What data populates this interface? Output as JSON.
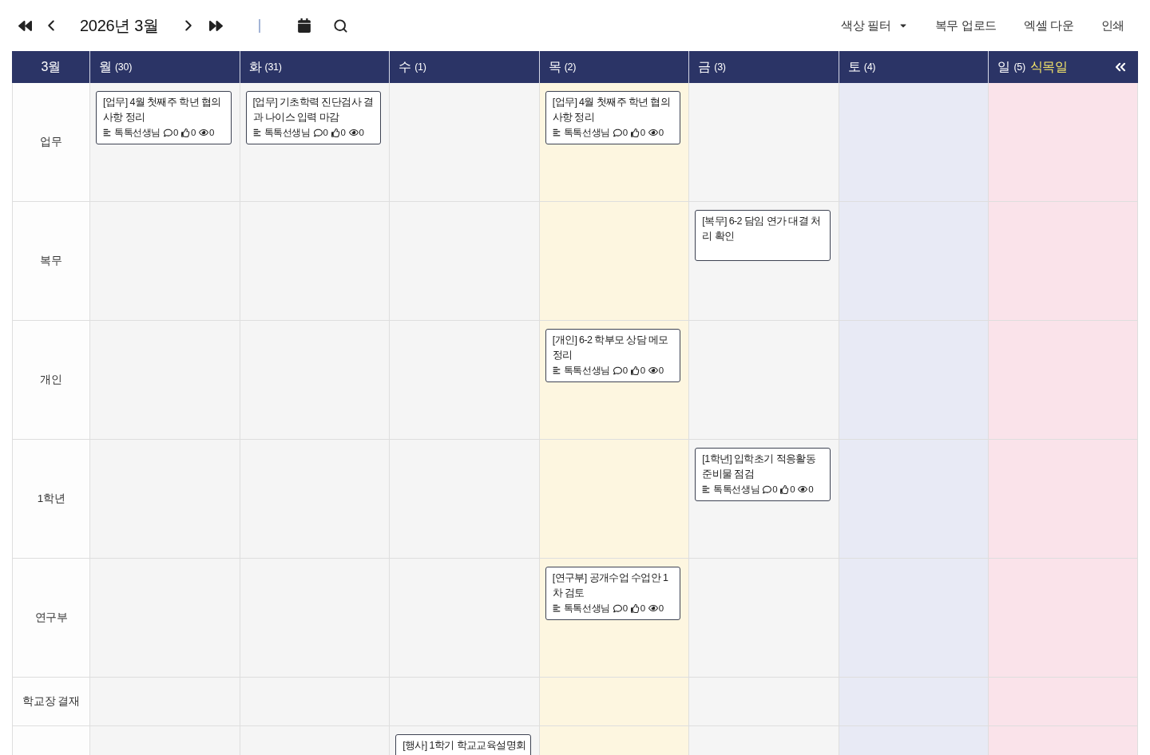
{
  "toolbar": {
    "title": "2026년 3월",
    "menu": [
      {
        "label": "색상 필터",
        "kind": "dropdown"
      },
      {
        "label": "복무 업로드",
        "kind": "link"
      },
      {
        "label": "엑셀 다운",
        "kind": "link"
      },
      {
        "label": "인쇄",
        "kind": "link"
      }
    ]
  },
  "header": {
    "month": "3월",
    "days": [
      {
        "weekday": "월",
        "date": "(30)",
        "kind": "weekday",
        "today": false
      },
      {
        "weekday": "화",
        "date": "(31)",
        "kind": "weekday",
        "today": false
      },
      {
        "weekday": "수",
        "date": "(1)",
        "kind": "weekday",
        "today": false
      },
      {
        "weekday": "목",
        "date": "(2)",
        "kind": "weekday",
        "today": true
      },
      {
        "weekday": "금",
        "date": "(3)",
        "kind": "weekday",
        "today": false
      },
      {
        "weekday": "토",
        "date": "(4)",
        "kind": "saturday",
        "today": false
      },
      {
        "weekday": "일",
        "date": "(5)",
        "kind": "sunday",
        "today": false,
        "holiday": "식목일"
      }
    ]
  },
  "rows": [
    {
      "label": "업무",
      "cells": [
        {
          "events": [
            {
              "title": "[업무] 4월 첫째주 학년 협의 사항 정리",
              "author": "톡톡선생님",
              "comments": "0",
              "likes": "0",
              "views": "0"
            }
          ]
        },
        {
          "events": [
            {
              "title": "[업무] 기초학력 진단검사 결과 나이스 입력 마감",
              "author": "톡톡선생님",
              "comments": "0",
              "likes": "0",
              "views": "0"
            }
          ]
        },
        {},
        {
          "events": [
            {
              "title": "[업무] 4월 첫째주 학년 협의 사항 정리",
              "author": "톡톡선생님",
              "comments": "0",
              "likes": "0",
              "views": "0"
            }
          ]
        },
        {},
        {},
        {}
      ]
    },
    {
      "label": "복무",
      "cells": [
        {},
        {},
        {},
        {},
        {
          "events": [
            {
              "title": "[복무] 6-2 담임 연가 대결 처리 확인"
            }
          ]
        },
        {},
        {}
      ]
    },
    {
      "label": "개인",
      "cells": [
        {},
        {},
        {},
        {
          "events": [
            {
              "title": "[개인] 6-2 학부모 상담 메모 정리",
              "author": "톡톡선생님",
              "comments": "0",
              "likes": "0",
              "views": "0"
            }
          ]
        },
        {},
        {},
        {}
      ]
    },
    {
      "label": "1학년",
      "cells": [
        {},
        {},
        {},
        {},
        {
          "events": [
            {
              "title": "[1학년] 입학초기 적응활동 준비물 점검",
              "author": "톡톡선생님",
              "comments": "0",
              "likes": "0",
              "views": "0"
            }
          ]
        },
        {},
        {}
      ]
    },
    {
      "label": "연구부",
      "cells": [
        {},
        {},
        {},
        {
          "events": [
            {
              "title": "[연구부] 공개수업 수업안 1차 검토",
              "author": "톡톡선생님",
              "comments": "0",
              "likes": "0",
              "views": "0"
            }
          ]
        },
        {},
        {},
        {}
      ]
    },
    {
      "label": "학교장 결재",
      "cells": [
        {},
        {},
        {},
        {},
        {},
        {},
        {}
      ]
    },
    {
      "cells": [
        {},
        {},
        {
          "events": [
            {
              "title": "[행사] 1학기 학교교육설명회"
            }
          ]
        },
        {},
        {},
        {},
        {}
      ]
    }
  ]
}
